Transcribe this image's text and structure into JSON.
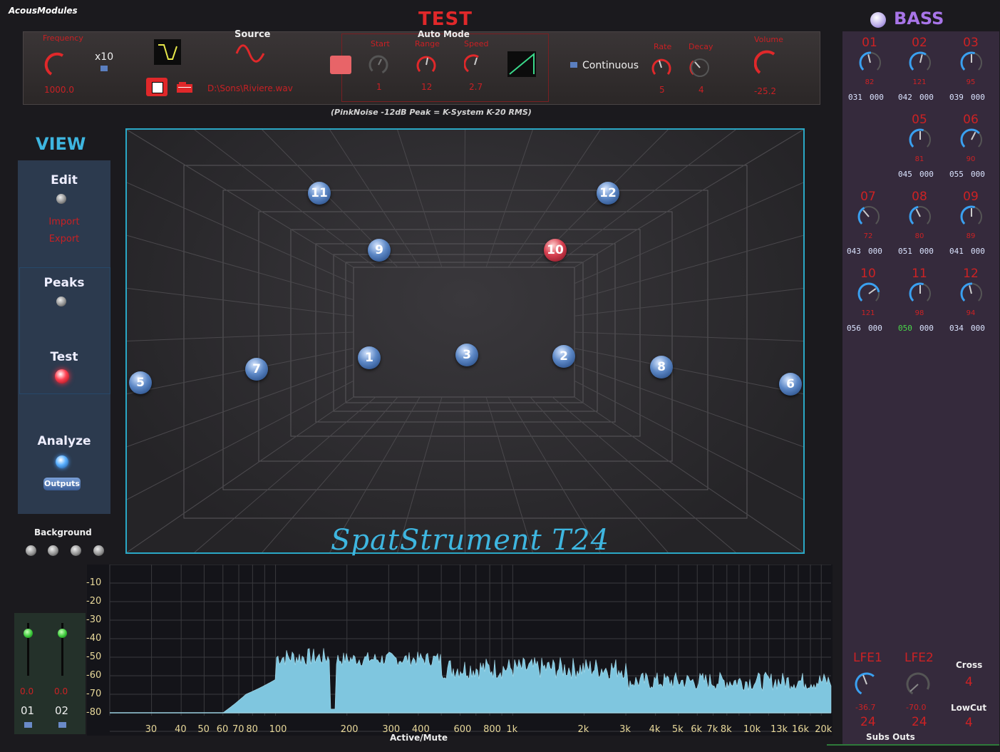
{
  "app": {
    "title": "AcousModules"
  },
  "test": {
    "title": "TEST",
    "frequency_label": "Frequency",
    "frequency_value": "1000.0",
    "x10_label": "x10",
    "source_label": "Source",
    "file_path": "D:\\Sons\\Riviere.wav",
    "auto_mode_label": "Auto Mode",
    "start_label": "Start",
    "start_value": "1",
    "range_label": "Range",
    "range_value": "12",
    "speed_label": "Speed",
    "speed_value": "2.7",
    "continuous_label": "Continuous",
    "rate_label": "Rate",
    "rate_value": "5",
    "decay_label": "Decay",
    "decay_value": "4",
    "volume_label": "Volume",
    "volume_value": "-25.2",
    "calibration_note": "(PinkNoise -12dB Peak = K-System K-20 RMS)"
  },
  "bass": {
    "title": "BASS",
    "channels": [
      {
        "num": "01",
        "val": "82",
        "code_a": "031",
        "code_b": "000"
      },
      {
        "num": "02",
        "val": "121",
        "code_a": "042",
        "code_b": "000"
      },
      {
        "num": "03",
        "val": "95",
        "code_a": "039",
        "code_b": "000"
      },
      {
        "num": "05",
        "val": "81",
        "code_a": "045",
        "code_b": "000"
      },
      {
        "num": "06",
        "val": "90",
        "code_a": "055",
        "code_b": "000"
      },
      {
        "num": "07",
        "val": "72",
        "code_a": "043",
        "code_b": "000"
      },
      {
        "num": "08",
        "val": "80",
        "code_a": "051",
        "code_b": "000"
      },
      {
        "num": "09",
        "val": "89",
        "code_a": "041",
        "code_b": "000"
      },
      {
        "num": "10",
        "val": "121",
        "code_a": "056",
        "code_b": "000"
      },
      {
        "num": "11",
        "val": "98",
        "code_a": "050",
        "code_b": "000"
      },
      {
        "num": "12",
        "val": "94",
        "code_a": "034",
        "code_b": "000"
      }
    ],
    "lfe1_label": "LFE1",
    "lfe1_value": "-36.7",
    "lfe1_out": "24",
    "lfe2_label": "LFE2",
    "lfe2_value": "-70.0",
    "lfe2_out": "24",
    "cross_label": "Cross",
    "cross_value": "4",
    "lowcut_label": "LowCut",
    "lowcut_value": "4",
    "subs_outs_label": "Subs Outs"
  },
  "view": {
    "title": "VIEW",
    "edit_label": "Edit",
    "import_label": "Import",
    "export_label": "Export",
    "peaks_label": "Peaks",
    "test_label": "Test",
    "analyze_label": "Analyze",
    "outputs_label": "Outputs",
    "background_label": "Background"
  },
  "stage": {
    "title": "SpatStrument  T24",
    "speakers": [
      "1",
      "2",
      "3",
      "5",
      "6",
      "7",
      "8",
      "9",
      "10",
      "11",
      "12"
    ]
  },
  "analyzer": {
    "y_ticks": [
      "-10",
      "-20",
      "-30",
      "-40",
      "-50",
      "-60",
      "-70",
      "-80"
    ],
    "x_ticks": [
      "30",
      "40",
      "50",
      "60",
      "70",
      "80",
      "100",
      "200",
      "300",
      "400",
      "600",
      "800",
      "1k",
      "2k",
      "3k",
      "4k",
      "5k",
      "6k",
      "7k",
      "8k",
      "10k",
      "13k",
      "16k",
      "20k"
    ],
    "bottom_label": "Active/Mute"
  },
  "faders": {
    "ch1_value": "0.0",
    "ch1_label": "01",
    "ch2_value": "0.0",
    "ch2_label": "02"
  },
  "colors": {
    "accent": "#3eb6e0",
    "alert": "#e0282a",
    "bass": "#a875e8",
    "spectrum": "#7fc6df"
  }
}
